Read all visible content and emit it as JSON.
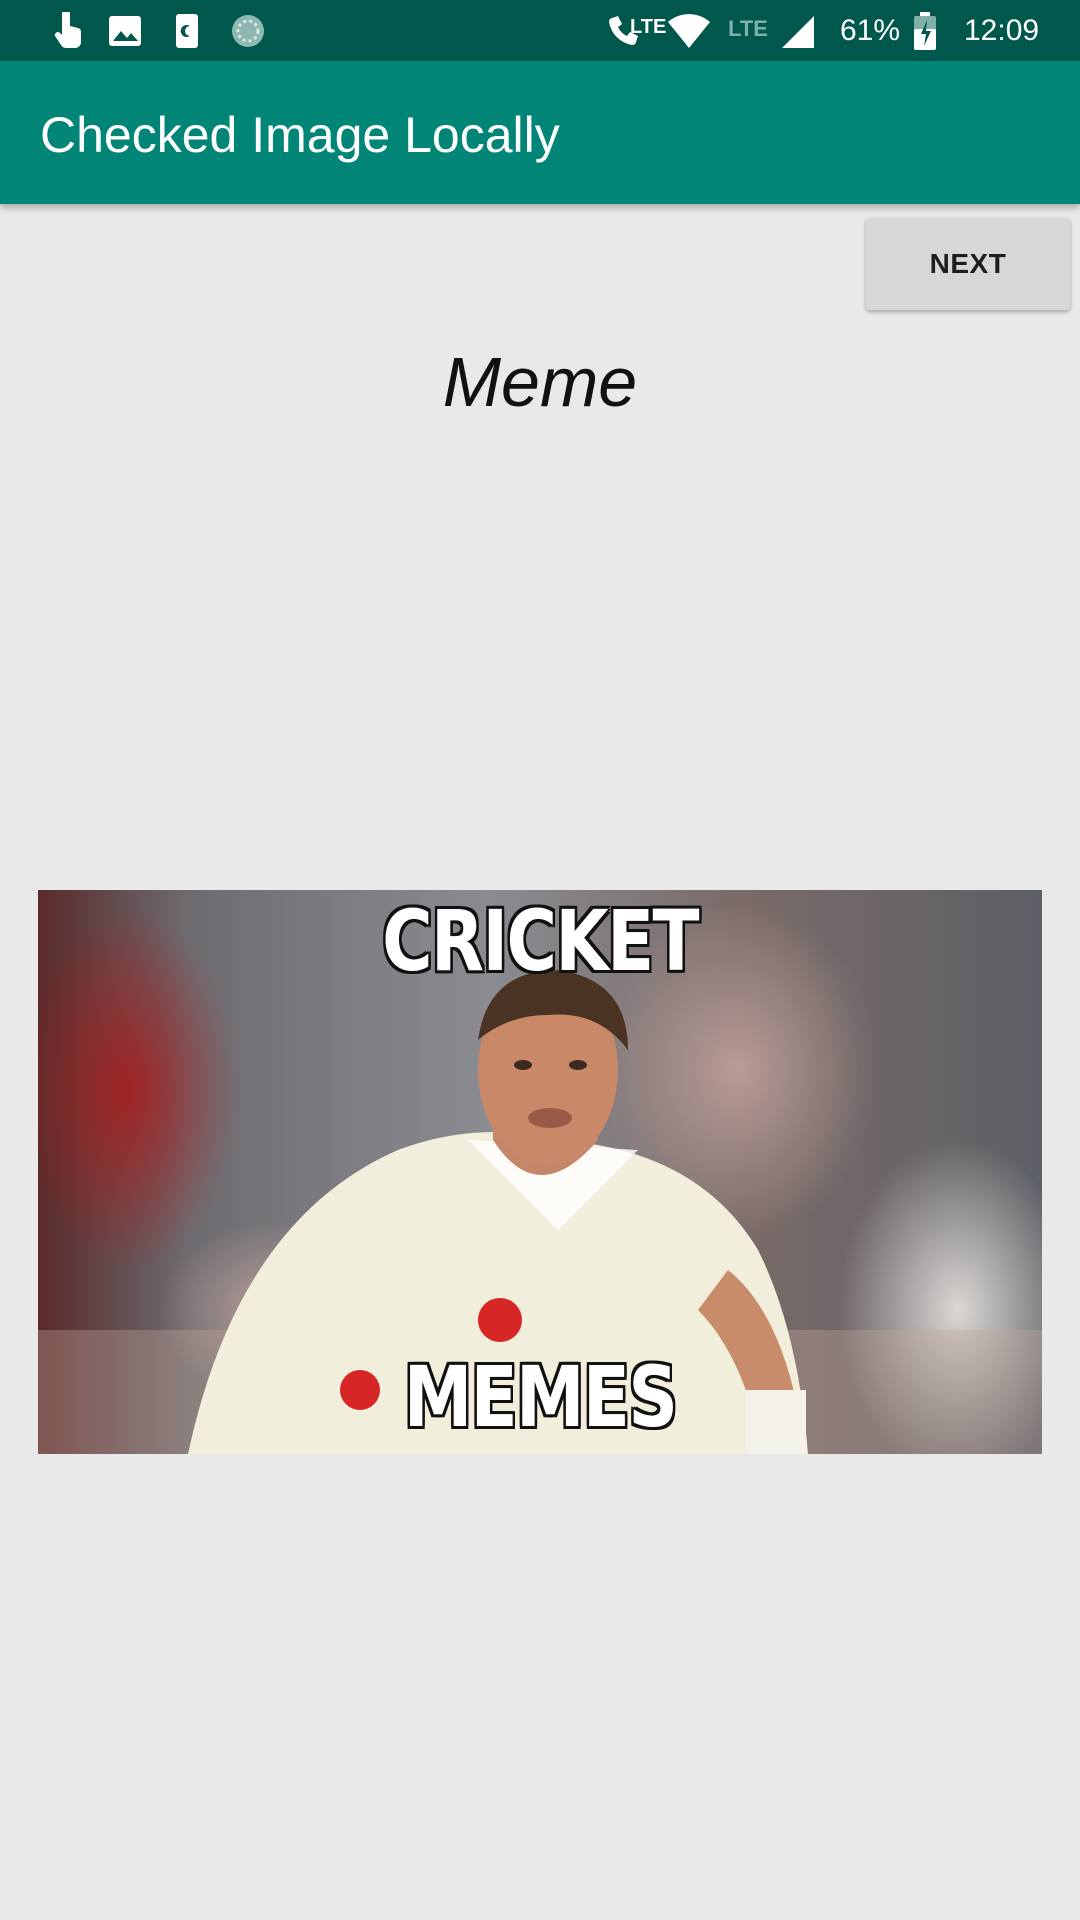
{
  "status_bar": {
    "battery": "61%",
    "time": "12:09",
    "network_label": "LTE",
    "call_label": "LTE",
    "icons": [
      "touch-icon",
      "image-icon",
      "sim-icon",
      "sync-icon",
      "lte-call-icon",
      "wifi-icon",
      "signal-icon",
      "battery-icon"
    ]
  },
  "app_bar": {
    "title": "Checked Image Locally"
  },
  "toolbar": {
    "next_label": "NEXT"
  },
  "content": {
    "heading": "Meme",
    "image": {
      "caption_top": "CRICKET",
      "caption_bottom": "MEMES"
    }
  },
  "colors": {
    "status_bar": "#00574b",
    "app_bar": "#008577",
    "background": "#e9e9e9",
    "button": "#d6d7d7"
  }
}
